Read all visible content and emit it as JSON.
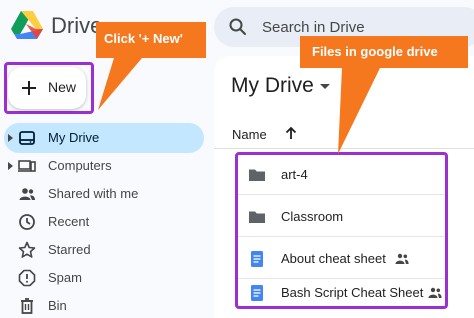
{
  "app": {
    "name": "Drive"
  },
  "search": {
    "placeholder": "Search in Drive"
  },
  "new_button": {
    "label": "New"
  },
  "sidebar": {
    "items": [
      {
        "label": "My Drive",
        "icon": "my-drive-icon",
        "active": true,
        "expandable": true
      },
      {
        "label": "Computers",
        "icon": "computers-icon",
        "active": false,
        "expandable": true
      },
      {
        "label": "Shared with me",
        "icon": "shared-with-me-icon",
        "active": false,
        "expandable": false
      },
      {
        "label": "Recent",
        "icon": "clock-icon",
        "active": false,
        "expandable": false
      },
      {
        "label": "Starred",
        "icon": "star-icon",
        "active": false,
        "expandable": false
      },
      {
        "label": "Spam",
        "icon": "spam-icon",
        "active": false,
        "expandable": false
      },
      {
        "label": "Bin",
        "icon": "trash-icon",
        "active": false,
        "expandable": false
      }
    ]
  },
  "main": {
    "title": "My Drive",
    "column_name": "Name",
    "files": [
      {
        "name": "art-4",
        "type": "folder",
        "shared": false
      },
      {
        "name": "Classroom",
        "type": "folder",
        "shared": false
      },
      {
        "name": "About cheat sheet",
        "type": "document",
        "shared": true
      },
      {
        "name": "Bash Script Cheat Sheet",
        "type": "document",
        "shared": true
      }
    ]
  },
  "annotations": {
    "new_callout": "Click  '+ New'",
    "files_callout": "Files in google drive"
  },
  "colors": {
    "annotation_orange": "#f5781e",
    "highlight_purple": "#9b2fd1",
    "active_nav": "#c2e7ff",
    "doc_blue": "#4285f4"
  }
}
